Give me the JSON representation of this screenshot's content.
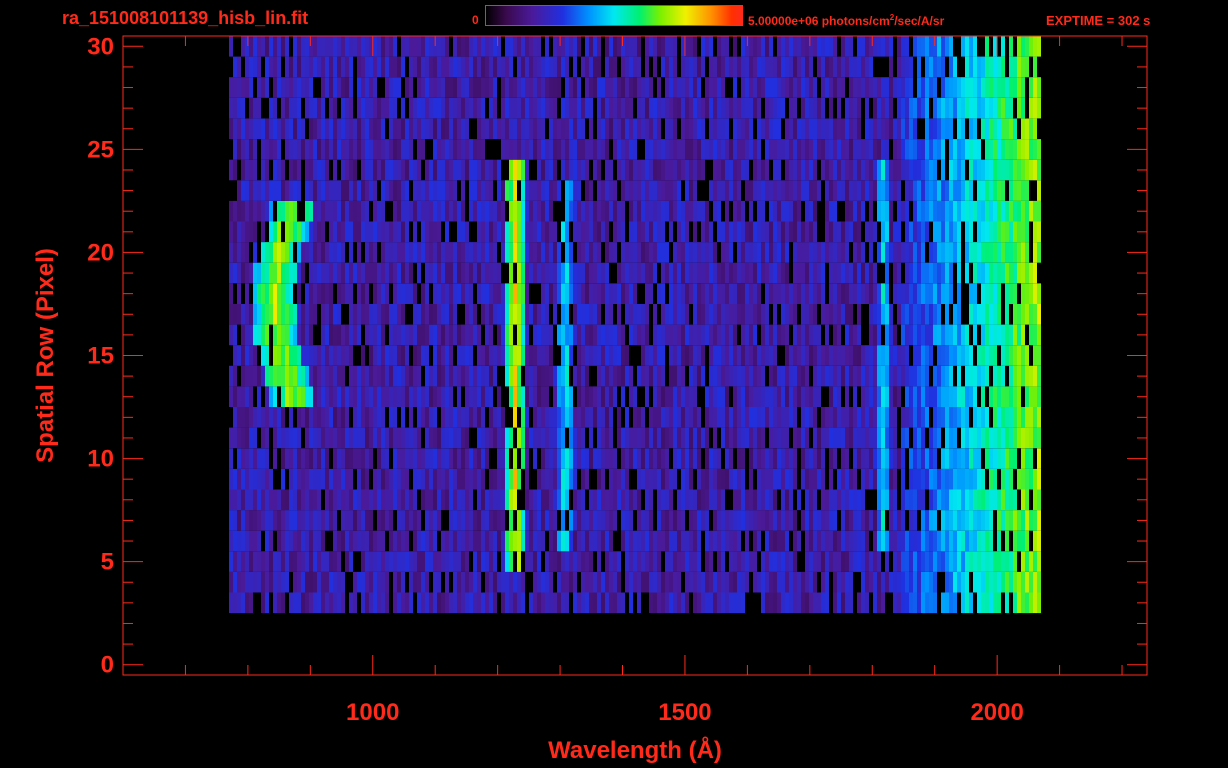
{
  "header": {
    "filename": "ra_151008101139_hisb_lin.fit",
    "colorbar_min": "0",
    "colorbar_max_label": "5.00000e+06 photons/cm",
    "colorbar_max_exp": "2",
    "colorbar_max_units": "/sec/A/sr",
    "exptime": "EXPTIME = 302 s"
  },
  "colors": {
    "axis": "#ff2a1a",
    "background": "#000000"
  },
  "chart_data": {
    "type": "heatmap",
    "xlabel": "Wavelength (Å)",
    "ylabel": "Spatial Row (Pixel)",
    "xlim": [
      600,
      2240
    ],
    "ylim": [
      -0.5,
      30.5
    ],
    "x_ticks": [
      1000,
      1500,
      2000
    ],
    "x_tick_labels": [
      "1000",
      "1500",
      "2000"
    ],
    "y_ticks": [
      0,
      5,
      10,
      15,
      20,
      25,
      30
    ],
    "y_tick_labels": [
      "0",
      "5",
      "10",
      "15",
      "20",
      "25",
      "30"
    ],
    "x_minor_step": 100,
    "y_minor_step": 1,
    "color_scale": {
      "min": 0,
      "max": 5000000,
      "units": "photons/cm2/sec/A/sr"
    },
    "data_extent": {
      "x_start": 770,
      "x_end": 2065,
      "row_start": 3,
      "row_end": 30
    },
    "features": [
      {
        "x_center": 840,
        "x_width": 70,
        "rows": [
          13,
          22
        ],
        "intensity": 0.72,
        "curved": true
      },
      {
        "x_center": 1225,
        "x_width": 32,
        "rows": [
          5,
          24
        ],
        "intensity": 0.78
      },
      {
        "x_center": 1305,
        "x_width": 25,
        "rows": [
          6,
          23
        ],
        "intensity": 0.5
      },
      {
        "x_center": 1815,
        "x_width": 22,
        "rows": [
          6,
          24
        ],
        "intensity": 0.5
      },
      {
        "x_center": 1990,
        "x_width": 150,
        "rows": [
          2,
          30
        ],
        "intensity": 0.45,
        "ramp": true
      }
    ]
  }
}
